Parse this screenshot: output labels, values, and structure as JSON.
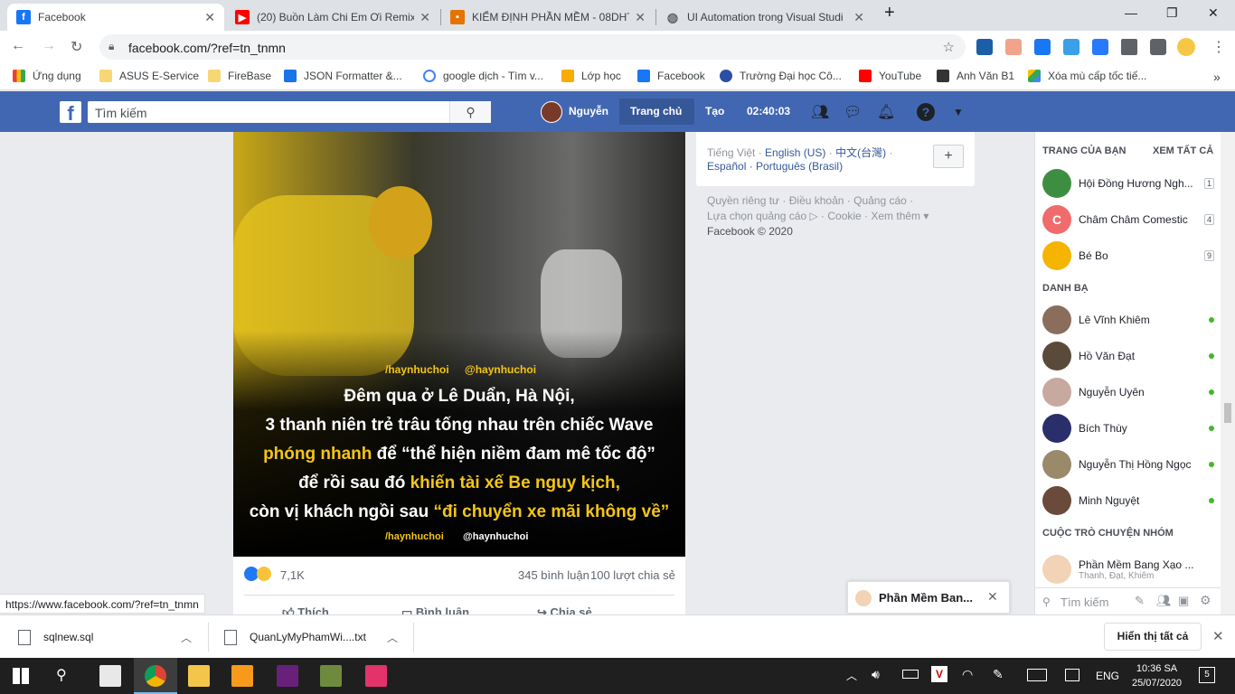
{
  "browser": {
    "tabs": [
      {
        "title": "Facebook",
        "active": true,
        "icon": "facebook-icon",
        "color": "#1877f2"
      },
      {
        "title": "(20) Buồn Làm Chi Em Ơi Remix,",
        "icon": "youtube-icon",
        "color": "#ff0000"
      },
      {
        "title": "KIỂM ĐỊNH PHẦN MỀM - 08DHT",
        "icon": "classroom-icon",
        "color": "#e37400"
      },
      {
        "title": "UI Automation trong Visual Studi",
        "icon": "globe-icon",
        "color": "#5f6368"
      }
    ],
    "url": "facebook.com/?ref=tn_tnmn",
    "bookmarks": [
      "Ứng dụng",
      "ASUS E-Service",
      "FireBase",
      "JSON Formatter &...",
      "google dịch - Tìm v...",
      "Lớp học",
      "Facebook",
      "Trường Đại học Cô...",
      "YouTube",
      "Anh Văn B1",
      "Xóa mù cấp tốc tiế..."
    ],
    "status_url": "https://www.facebook.com/?ref=tn_tnmn"
  },
  "fb": {
    "search_placeholder": "Tìm kiếm",
    "user": "Nguyễn",
    "home": "Trang chủ",
    "create": "Tạo",
    "time": "02:40:03"
  },
  "post": {
    "caption": [
      {
        "text": "Đêm qua ở Lê Duẩn, Hà Nội,"
      },
      {
        "text": "3 thanh niên trẻ trâu tống nhau trên chiếc Wave"
      },
      {
        "a": "phóng nhanh",
        "b": " để ",
        "c": "“thể hiện niềm đam mê tốc độ”"
      },
      {
        "a": "để rồi sau đó ",
        "b": "khiến tài xế Be nguy kịch,"
      },
      {
        "a": "còn vị khách ngồi sau ",
        "b": "“đi chuyển xe mãi không về”"
      }
    ],
    "watermark": "/haynhuchoi",
    "watermark2": "@haynhuchoi",
    "reactions": "7,1K",
    "comments": "345 bình luận",
    "shares": "100 lượt chia sẻ",
    "actions": [
      "Thích",
      "Bình luận",
      "Chia sẻ"
    ]
  },
  "right": {
    "lang_line1_a": "Tiếng Việt",
    "lang_line1_b": "English (US)",
    "lang_line1_c": "中文(台灣)",
    "lang_line2_a": "Español",
    "lang_line2_b": "Português (Brasil)",
    "footer_line1": "Quyền riêng tư · Điều khoản · Quảng cáo ·",
    "footer_line2": "Lựa chọn quảng cáo ▷ · Cookie · Xem thêm ▾",
    "footer_line3": "Facebook © 2020"
  },
  "sidebar": {
    "pages_title": "TRANG CỦA BẠN",
    "see_all": "XEM TẤT CẢ",
    "pages": [
      {
        "name": "Hội Đồng Hương Ngh...",
        "badge": "1",
        "color": "#3e8e41"
      },
      {
        "name": "Châm Châm Comestic",
        "badge": "4",
        "color": "#f06b6b",
        "letter": "C"
      },
      {
        "name": "Bé Bo",
        "badge": "9",
        "color": "#f5b400"
      }
    ],
    "contacts_title": "DANH BẠ",
    "contacts": [
      {
        "name": "Lê Vĩnh Khiêm",
        "color": "#8a6d5a"
      },
      {
        "name": "Hồ Văn Đạt",
        "color": "#5a4a3a"
      },
      {
        "name": "Nguyễn Uyên",
        "color": "#c7a9a0"
      },
      {
        "name": "Bích Thùy",
        "color": "#2a2f6b"
      },
      {
        "name": "Nguyễn Thị Hồng Ngọc",
        "color": "#9a8a6a"
      },
      {
        "name": "Minh Nguyệt",
        "color": "#6a4a3a"
      }
    ],
    "groups_title": "CUỘC TRÒ CHUYỆN NHÓM",
    "group_name": "Phần Mềm Bang Xạo ...",
    "group_members": "Thanh, Đạt, Khiêm",
    "search_placeholder": "Tìm kiếm"
  },
  "chat": {
    "title": "Phần Mềm Ban..."
  },
  "downloads": {
    "items": [
      "sqlnew.sql",
      "QuanLyMyPhamWi....txt"
    ],
    "show_all": "Hiển thị tất cả"
  },
  "taskbar": {
    "lang": "ENG",
    "time": "10:36 SA",
    "date": "25/07/2020",
    "notif": "5"
  }
}
